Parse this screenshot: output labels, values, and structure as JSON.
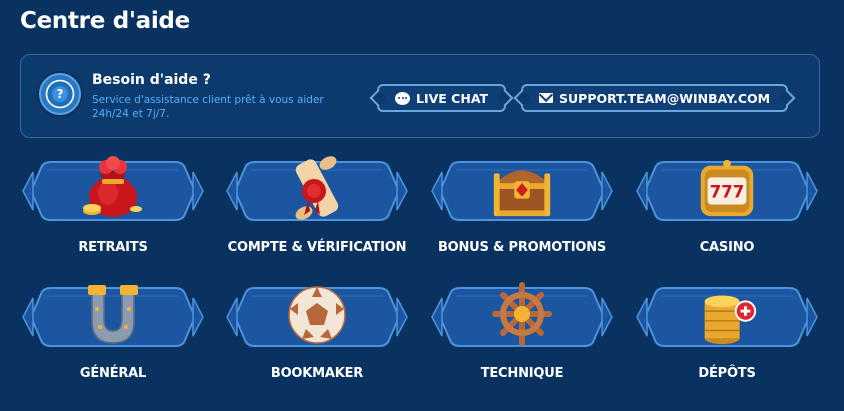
{
  "page": {
    "title": "Centre d'aide"
  },
  "help": {
    "title": "Besoin d'aide ?",
    "subtitle": "Service d'assistance client prêt à vous aider 24h/24 et 7j/7.",
    "chat_label": "LIVE CHAT",
    "email_label": "SUPPORT.TEAM@WINBAY.COM",
    "icon": "question-icon",
    "accent_color": "#4fb0ff"
  },
  "categories": [
    {
      "label": "RETRAITS",
      "icon": "money-bag-icon"
    },
    {
      "label": "COMPTE & VÉRIFICATION",
      "icon": "scroll-seal-icon"
    },
    {
      "label": "BONUS & PROMOTIONS",
      "icon": "treasure-chest-icon"
    },
    {
      "label": "CASINO",
      "icon": "slot-machine-icon"
    },
    {
      "label": "GÉNÉRAL",
      "icon": "horseshoe-icon"
    },
    {
      "label": "BOOKMAKER",
      "icon": "football-icon"
    },
    {
      "label": "TECHNIQUE",
      "icon": "ship-wheel-icon"
    },
    {
      "label": "DÉPÔTS",
      "icon": "coin-stack-icon"
    }
  ],
  "colors": {
    "background": "#0a3260",
    "card_plate": "#1c56a0",
    "card_border": "#4b93dc",
    "gold": "#e7a62b"
  }
}
